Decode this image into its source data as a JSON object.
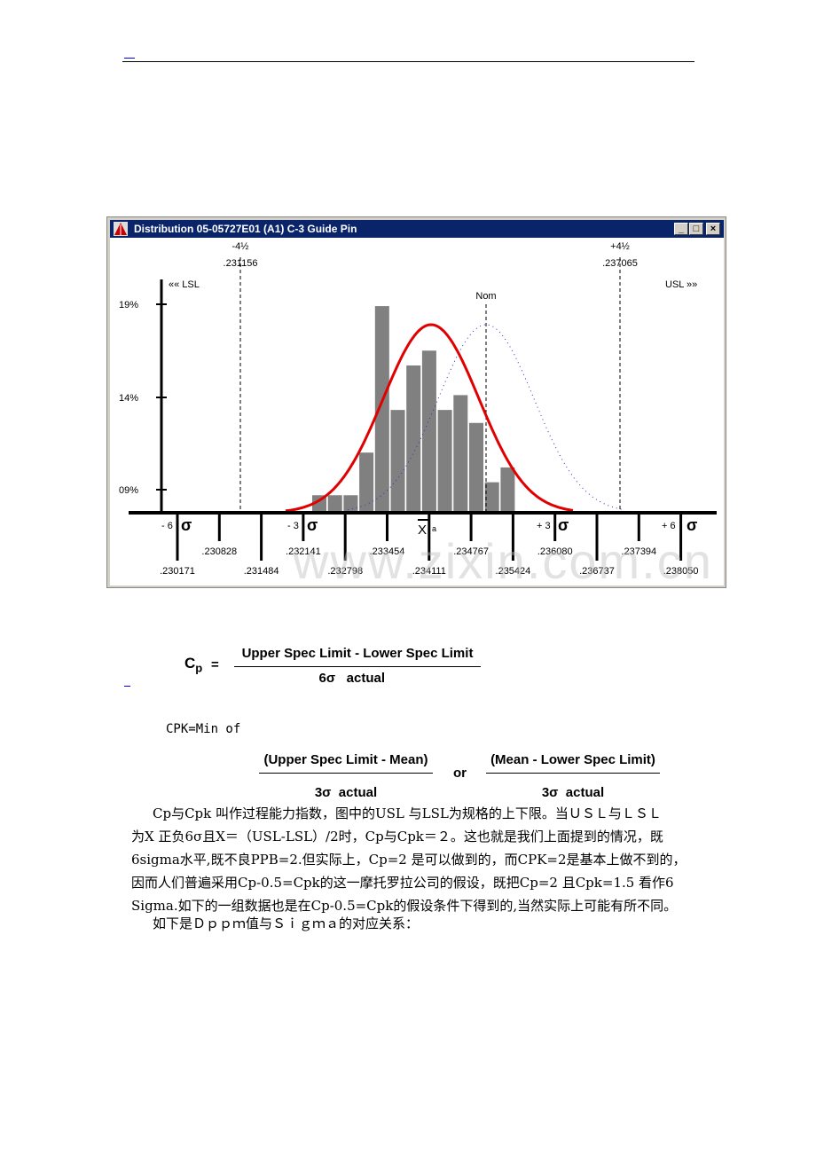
{
  "window": {
    "title": "Distribution 05-05727E01 (A1) C-3 Guide Pin",
    "buttons": [
      "_",
      "□",
      "×"
    ]
  },
  "chart_data": {
    "type": "bar",
    "title": "Distribution 05-05727E01 (A1) C-3 Guide Pin",
    "y_ticks": [
      "19%",
      "14%",
      "09%"
    ],
    "bar_values_percent": [
      8.7,
      8.7,
      8.7,
      11.0,
      18.9,
      13.3,
      15.7,
      16.5,
      13.3,
      14.1,
      12.6,
      9.4,
      10.2
    ],
    "spec_lines": {
      "lsl_label": "«« LSL",
      "usl_label": "USL »»",
      "lower_sigma_label": "-4½",
      "lower_value": ".231156",
      "upper_sigma_label": "+4½",
      "upper_value": ".237065",
      "nominal_label": "Nom"
    },
    "sigma_labels": [
      "- 6",
      "- 3",
      "+ 3",
      "+ 6"
    ],
    "sigma_symbol": "σ",
    "mean_label": "X",
    "mean_sub": "a",
    "x_ticks_upper": [
      ".230828",
      ".232141",
      ".233454",
      ".234767",
      ".236080",
      ".237394"
    ],
    "x_ticks_lower": [
      ".230171",
      ".231484",
      ".232798",
      ".234111",
      ".235424",
      ".236737",
      ".238050"
    ],
    "curves": {
      "actual_color": "#e00000",
      "nominal_color": "#3030c0"
    },
    "bar_color": "#808080"
  },
  "watermark": "www.zixin.com.cn",
  "formulas": {
    "cp_lhs": "C",
    "cp_sub": "p",
    "equals": "=",
    "cp_num": "Upper Spec Limit - Lower Spec Limit",
    "cp_den": "6σ   actual",
    "cpk_intro": "CPK=Min of",
    "cpk_num1": "(Upper Spec Limit - Mean)",
    "cpk_den1": "3σ  actual",
    "or": "or",
    "cpk_num2": "(Mean - Lower Spec Limit)",
    "cpk_den2": "3σ  actual"
  },
  "paragraph": [
    "Cp与Cpk 叫作过程能力指数，图中的USL 与LSL为规格的上下限。当ＵＳＬ与ＬＳＬ",
    "为X 正负6σ且X＝（USL-LSL）/2时，Cp与Cpk＝２。这也就是我们上面提到的情况，既",
    "6sigma水平,既不良PPB=2.但实际上，Cp=2 是可以做到的，而CPK=2是基本上做不到的，",
    "因而人们普遍采用Cp-0.5=Cpk的这一摩托罗拉公司的假设，既把Cp=2 且Cpk=1.5 看作6",
    "Sigma.如下的一组数据也是在Cp-0.5=Cpk的假设条件下得到的,当然实际上可能有所不同。"
  ],
  "closing_line": "如下是Ｄｐｐｍ值与Ｓｉｇｍａ的对应关系："
}
